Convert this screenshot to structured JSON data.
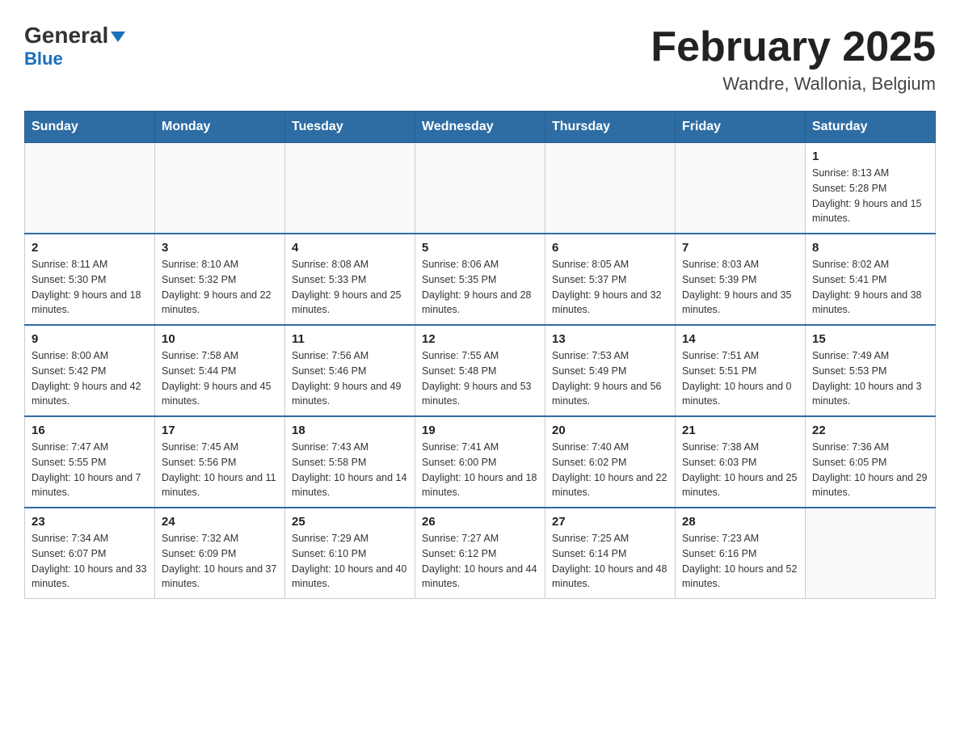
{
  "header": {
    "logo_general": "General",
    "logo_blue": "Blue",
    "title": "February 2025",
    "subtitle": "Wandre, Wallonia, Belgium"
  },
  "days_of_week": [
    "Sunday",
    "Monday",
    "Tuesday",
    "Wednesday",
    "Thursday",
    "Friday",
    "Saturday"
  ],
  "weeks": [
    {
      "days": [
        {
          "number": "",
          "info": ""
        },
        {
          "number": "",
          "info": ""
        },
        {
          "number": "",
          "info": ""
        },
        {
          "number": "",
          "info": ""
        },
        {
          "number": "",
          "info": ""
        },
        {
          "number": "",
          "info": ""
        },
        {
          "number": "1",
          "info": "Sunrise: 8:13 AM\nSunset: 5:28 PM\nDaylight: 9 hours and 15 minutes."
        }
      ]
    },
    {
      "days": [
        {
          "number": "2",
          "info": "Sunrise: 8:11 AM\nSunset: 5:30 PM\nDaylight: 9 hours and 18 minutes."
        },
        {
          "number": "3",
          "info": "Sunrise: 8:10 AM\nSunset: 5:32 PM\nDaylight: 9 hours and 22 minutes."
        },
        {
          "number": "4",
          "info": "Sunrise: 8:08 AM\nSunset: 5:33 PM\nDaylight: 9 hours and 25 minutes."
        },
        {
          "number": "5",
          "info": "Sunrise: 8:06 AM\nSunset: 5:35 PM\nDaylight: 9 hours and 28 minutes."
        },
        {
          "number": "6",
          "info": "Sunrise: 8:05 AM\nSunset: 5:37 PM\nDaylight: 9 hours and 32 minutes."
        },
        {
          "number": "7",
          "info": "Sunrise: 8:03 AM\nSunset: 5:39 PM\nDaylight: 9 hours and 35 minutes."
        },
        {
          "number": "8",
          "info": "Sunrise: 8:02 AM\nSunset: 5:41 PM\nDaylight: 9 hours and 38 minutes."
        }
      ]
    },
    {
      "days": [
        {
          "number": "9",
          "info": "Sunrise: 8:00 AM\nSunset: 5:42 PM\nDaylight: 9 hours and 42 minutes."
        },
        {
          "number": "10",
          "info": "Sunrise: 7:58 AM\nSunset: 5:44 PM\nDaylight: 9 hours and 45 minutes."
        },
        {
          "number": "11",
          "info": "Sunrise: 7:56 AM\nSunset: 5:46 PM\nDaylight: 9 hours and 49 minutes."
        },
        {
          "number": "12",
          "info": "Sunrise: 7:55 AM\nSunset: 5:48 PM\nDaylight: 9 hours and 53 minutes."
        },
        {
          "number": "13",
          "info": "Sunrise: 7:53 AM\nSunset: 5:49 PM\nDaylight: 9 hours and 56 minutes."
        },
        {
          "number": "14",
          "info": "Sunrise: 7:51 AM\nSunset: 5:51 PM\nDaylight: 10 hours and 0 minutes."
        },
        {
          "number": "15",
          "info": "Sunrise: 7:49 AM\nSunset: 5:53 PM\nDaylight: 10 hours and 3 minutes."
        }
      ]
    },
    {
      "days": [
        {
          "number": "16",
          "info": "Sunrise: 7:47 AM\nSunset: 5:55 PM\nDaylight: 10 hours and 7 minutes."
        },
        {
          "number": "17",
          "info": "Sunrise: 7:45 AM\nSunset: 5:56 PM\nDaylight: 10 hours and 11 minutes."
        },
        {
          "number": "18",
          "info": "Sunrise: 7:43 AM\nSunset: 5:58 PM\nDaylight: 10 hours and 14 minutes."
        },
        {
          "number": "19",
          "info": "Sunrise: 7:41 AM\nSunset: 6:00 PM\nDaylight: 10 hours and 18 minutes."
        },
        {
          "number": "20",
          "info": "Sunrise: 7:40 AM\nSunset: 6:02 PM\nDaylight: 10 hours and 22 minutes."
        },
        {
          "number": "21",
          "info": "Sunrise: 7:38 AM\nSunset: 6:03 PM\nDaylight: 10 hours and 25 minutes."
        },
        {
          "number": "22",
          "info": "Sunrise: 7:36 AM\nSunset: 6:05 PM\nDaylight: 10 hours and 29 minutes."
        }
      ]
    },
    {
      "days": [
        {
          "number": "23",
          "info": "Sunrise: 7:34 AM\nSunset: 6:07 PM\nDaylight: 10 hours and 33 minutes."
        },
        {
          "number": "24",
          "info": "Sunrise: 7:32 AM\nSunset: 6:09 PM\nDaylight: 10 hours and 37 minutes."
        },
        {
          "number": "25",
          "info": "Sunrise: 7:29 AM\nSunset: 6:10 PM\nDaylight: 10 hours and 40 minutes."
        },
        {
          "number": "26",
          "info": "Sunrise: 7:27 AM\nSunset: 6:12 PM\nDaylight: 10 hours and 44 minutes."
        },
        {
          "number": "27",
          "info": "Sunrise: 7:25 AM\nSunset: 6:14 PM\nDaylight: 10 hours and 48 minutes."
        },
        {
          "number": "28",
          "info": "Sunrise: 7:23 AM\nSunset: 6:16 PM\nDaylight: 10 hours and 52 minutes."
        },
        {
          "number": "",
          "info": ""
        }
      ]
    }
  ]
}
